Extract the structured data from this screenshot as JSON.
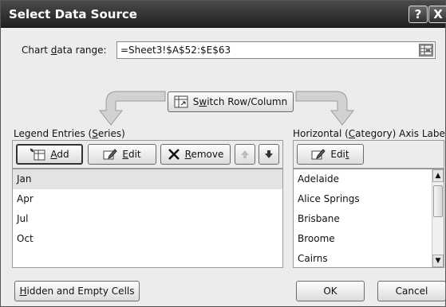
{
  "window": {
    "title": "Select Data Source",
    "help_glyph": "?",
    "close_glyph": "X"
  },
  "range": {
    "label_pre": "Chart ",
    "label_key": "d",
    "label_post": "ata range:",
    "value": "=Sheet3!$A$52:$E$63"
  },
  "switch": {
    "label_pre": "S",
    "label_key": "w",
    "label_post": "itch Row/Column"
  },
  "legend": {
    "label_pre": "Legend Entries (",
    "label_key": "S",
    "label_post": "eries)",
    "add": {
      "key": "A",
      "rest": "dd"
    },
    "edit": {
      "key": "E",
      "rest": "dit"
    },
    "remove": {
      "key": "R",
      "rest": "emove"
    },
    "items": [
      "Jan",
      "Apr",
      "Jul",
      "Oct"
    ],
    "selected_index": 0
  },
  "axis": {
    "label_pre": "Horizontal (",
    "label_key": "C",
    "label_post": "ategory) Axis Labels",
    "edit": {
      "pre": "Edi",
      "key": "t"
    },
    "items": [
      "Adelaide",
      "Alice Springs",
      "Brisbane",
      "Broome",
      "Cairns"
    ]
  },
  "footer": {
    "hidden": {
      "key": "H",
      "rest": "idden and Empty Cells"
    },
    "ok": "OK",
    "cancel": "Cancel"
  },
  "icons": {
    "range_collapse": "range-collapse-icon",
    "switch": "switch-row-column-icon",
    "add": "add-series-icon",
    "edit": "edit-pencil-icon",
    "remove": "remove-x-icon",
    "up": "move-up-arrow-icon",
    "down": "move-down-arrow-icon"
  }
}
